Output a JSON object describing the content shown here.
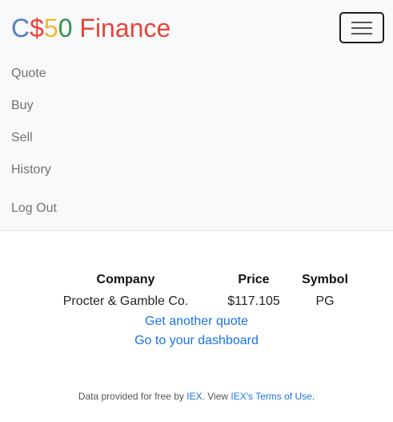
{
  "brand": {
    "parts": [
      {
        "text": "C",
        "color": "#537fbe"
      },
      {
        "text": "$",
        "color": "#ea433b"
      },
      {
        "text": "5",
        "color": "#f5b82e"
      },
      {
        "text": "0",
        "color": "#2e944b"
      },
      {
        "text": " Finance",
        "color": "#ea433b"
      }
    ]
  },
  "nav": {
    "toggler_icon": "hamburger-menu-icon",
    "items": [
      {
        "label": "Quote"
      },
      {
        "label": "Buy"
      },
      {
        "label": "Sell"
      },
      {
        "label": "History"
      }
    ],
    "logout": "Log Out"
  },
  "quote": {
    "headers": [
      "Company",
      "Price",
      "Symbol"
    ],
    "row": {
      "company": "Procter & Gamble Co.",
      "price": "$117.105",
      "symbol": "PG"
    }
  },
  "links": {
    "another": "Get another quote",
    "dashboard": "Go to your dashboard"
  },
  "footer": {
    "prefix": "Data provided for free by ",
    "iex": "IEX",
    "mid": ". View ",
    "terms": "IEX's Terms of Use",
    "suffix": "."
  },
  "colors": {
    "link": "#1a73e8",
    "navbar_bg": "#f8f9fa"
  }
}
